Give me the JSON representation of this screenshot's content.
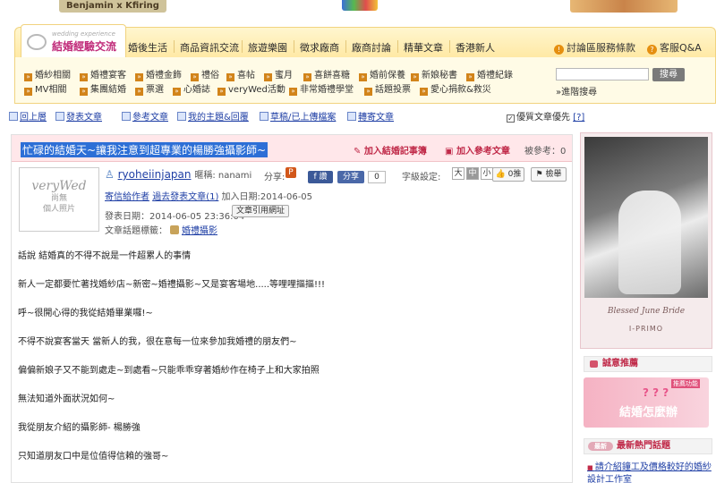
{
  "top_banners": {
    "left": "Benjamin x Kfiring"
  },
  "logo": {
    "subtitle": "wedding experience",
    "title": "結婚經驗交流"
  },
  "nav": {
    "tabs": [
      "婚後生活",
      "商品資訊交流",
      "旅遊樂園",
      "徵求廠商",
      "廠商討論",
      "精華文章",
      "香港新人"
    ],
    "terms": "討論區服務條款",
    "faq": "客服Q&A"
  },
  "categories": [
    [
      "婚紗相關",
      "婚禮宴客",
      "婚禮金飾",
      "禮俗",
      "喜帖",
      "蜜月",
      "喜餅喜糖",
      "婚前保養",
      "新娘秘書",
      "婚禮紀錄"
    ],
    [
      "MV相關",
      "集團結婚",
      "票選",
      "心婚誌",
      "veryWed活動",
      "非常婚禮學堂",
      "話題投票",
      "愛心捐款&救災"
    ]
  ],
  "search": {
    "button": "搜尋",
    "advanced": "進階搜尋"
  },
  "toolbar": {
    "items": [
      "回上層",
      "發表文章",
      "參考文章",
      "我的主題&回覆",
      "草稿/已上傳檔案",
      "轉寄文章"
    ],
    "pref": "優質文章優先",
    "help": "[?]"
  },
  "post": {
    "title": "忙碌的結婚天~讓我注意到超專業的楊勝強攝影師~",
    "add_diary": "加入結婚記事簿",
    "add_ref": "加入參考文章",
    "reply_count": "被參考：0",
    "avatar_logo": "veryWed",
    "avatar_text": "尚無\n個人照片",
    "author": "ryoheiinjapan",
    "nickname_label": "暱稱: nanami",
    "share_label": "分享:",
    "share_p": "P",
    "fb_label": "讚",
    "fb_share": "分享",
    "share_count": "0",
    "font_label": "字級設定:",
    "font_sizes": [
      "大",
      "中",
      "小"
    ],
    "push": "0推",
    "report": "檢舉",
    "msg_author": "寄信給作者",
    "past_posts": "過去發表文章(1)",
    "join_date": "加入日期:2014-06-05",
    "post_date": "發表日期：2014-06-05 23:36:04",
    "copy_url": "文章引用網址",
    "topic_label": "文章話題標籤：",
    "topic": "婚禮攝影",
    "paragraphs": [
      "話說 結婚真的不得不說是一件超累人的事情",
      "新人一定都要忙著找婚紗店~新密~婚禮攝影~又是宴客場地.....等哩哩摳摳!!!",
      "呼~很開心得的我從結婚畢業囉!~",
      "不得不說宴客當天 當新人的我，很在意每一位來參加我婚禮的朋友們~",
      "偏偏新娘子又不能到處走~到處看~只能乖乖穿著婚紗作在椅子上和大家拍照",
      "無法知道外面狀況如何~",
      "我從朋友介紹的攝影師- 楊勝強",
      "只知道朋友口中是位值得信賴的強哥~"
    ]
  },
  "sidebar": {
    "ad_caption": "Blessed June Bride",
    "ad_brand": "I-PRIMO",
    "rec_header": "誠意推薦",
    "rec_corner": "推薦功能",
    "rec_title": "結婚怎麼辦",
    "hot_tag": "最新",
    "hot_header": "最新熱門話題",
    "hot_item": "請介紹鐘工及價格較好的婚紗設計工作室"
  },
  "colors": {
    "accent": "#c02a79",
    "nav_bg": "#ffe9a5",
    "link": "#1f3fa5",
    "title_highlight": "#2d6fd6"
  }
}
